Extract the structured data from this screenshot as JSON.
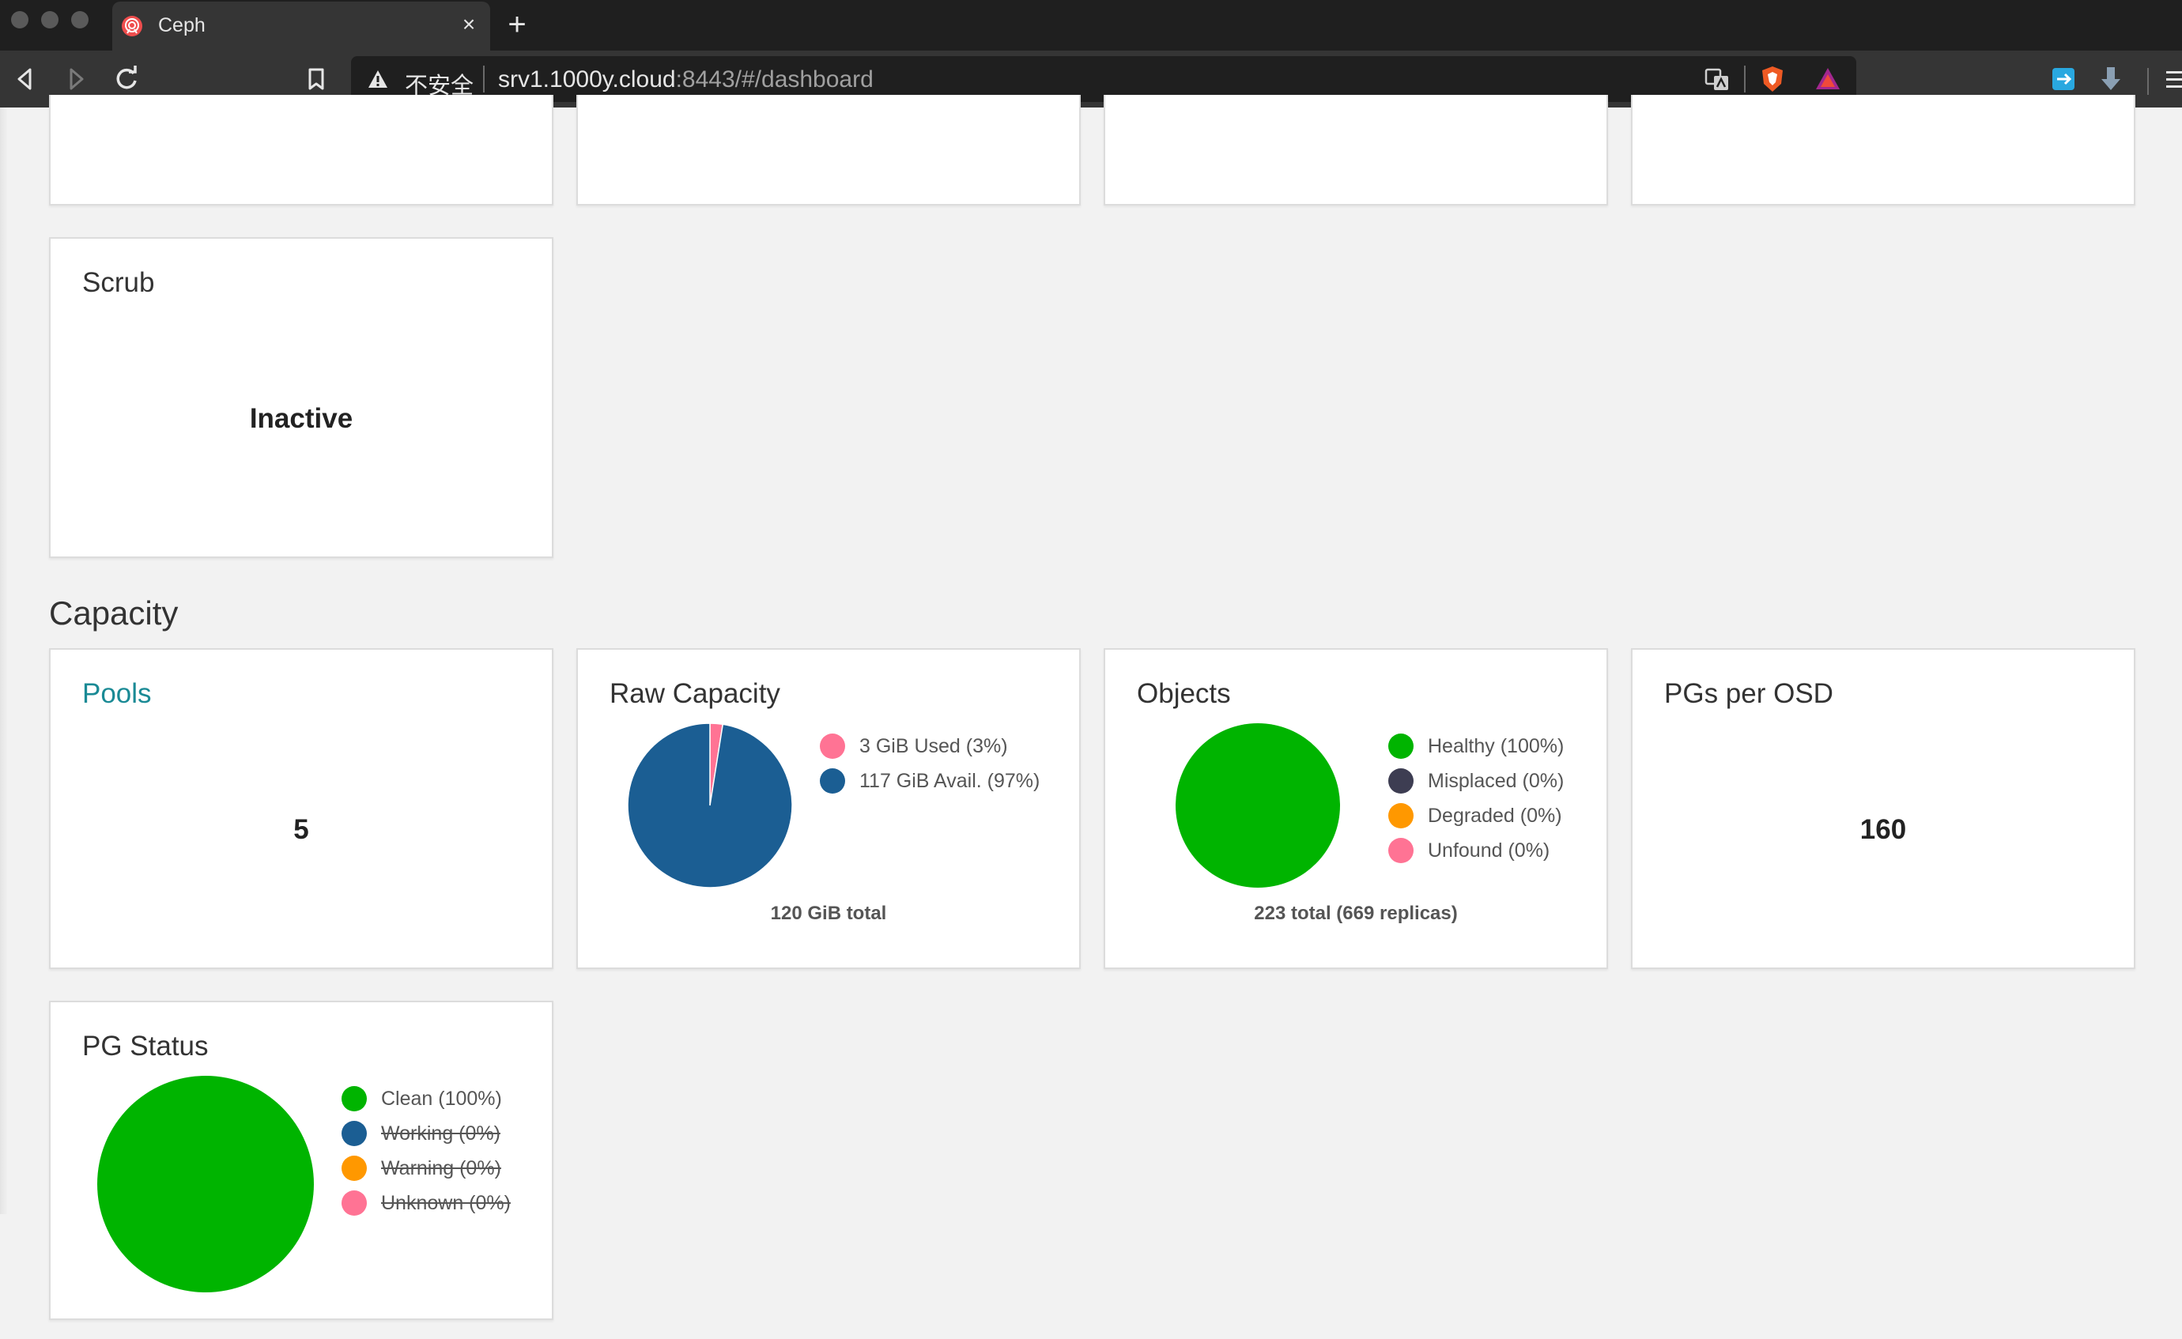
{
  "browser": {
    "tab_title": "Ceph",
    "close_label": "×",
    "new_tab_label": "+",
    "security_label": "不安全",
    "url_host": "srv1.1000y.cloud",
    "url_rest": ":8443/#/dashboard"
  },
  "dashboard": {
    "scrub": {
      "title": "Scrub",
      "value": "Inactive"
    },
    "capacity_heading": "Capacity",
    "pools": {
      "title": "Pools",
      "value": "5"
    },
    "raw_capacity": {
      "title": "Raw Capacity",
      "legend": [
        {
          "label": "3 GiB Used (3%)",
          "color": "#ff7394"
        },
        {
          "label": "117 GiB Avail. (97%)",
          "color": "#1b5e93"
        }
      ],
      "total": "120 GiB total"
    },
    "objects": {
      "title": "Objects",
      "legend": [
        {
          "label": "Healthy (100%)",
          "color": "#00b400"
        },
        {
          "label": "Misplaced (0%)",
          "color": "#3d3d52"
        },
        {
          "label": "Degraded (0%)",
          "color": "#ff9800"
        },
        {
          "label": "Unfound (0%)",
          "color": "#ff7394"
        }
      ],
      "total": "223 total (669 replicas)"
    },
    "pgs_per_osd": {
      "title": "PGs per OSD",
      "value": "160"
    },
    "pg_status": {
      "title": "PG Status",
      "legend": [
        {
          "label": "Clean (100%)",
          "color": "#00b400",
          "struck": false
        },
        {
          "label": "Working (0%)",
          "color": "#1b5e93",
          "struck": true
        },
        {
          "label": "Warning (0%)",
          "color": "#ff9800",
          "struck": true
        },
        {
          "label": "Unknown (0%)",
          "color": "#ff7394",
          "struck": true
        }
      ]
    }
  },
  "chart_data": [
    {
      "type": "pie",
      "title": "Raw Capacity",
      "categories": [
        "Used",
        "Avail."
      ],
      "values": [
        3,
        117
      ],
      "units": "GiB"
    },
    {
      "type": "pie",
      "title": "Objects",
      "categories": [
        "Healthy",
        "Misplaced",
        "Degraded",
        "Unfound"
      ],
      "values": [
        100,
        0,
        0,
        0
      ],
      "units": "%"
    },
    {
      "type": "pie",
      "title": "PG Status",
      "categories": [
        "Clean",
        "Working",
        "Warning",
        "Unknown"
      ],
      "values": [
        100,
        0,
        0,
        0
      ],
      "units": "%"
    }
  ]
}
